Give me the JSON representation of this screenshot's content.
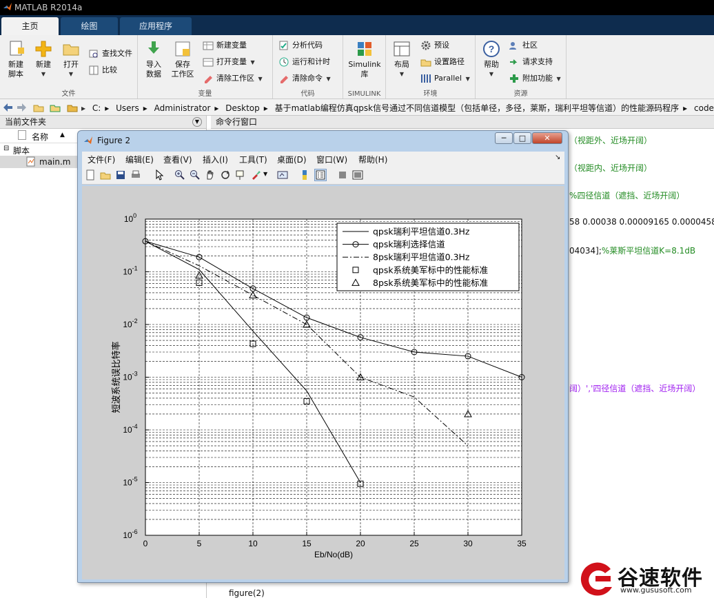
{
  "window": {
    "title": "MATLAB R2014a"
  },
  "tabs": [
    {
      "label": "主页",
      "active": true
    },
    {
      "label": "绘图",
      "active": false
    },
    {
      "label": "应用程序",
      "active": false
    }
  ],
  "ribbon": {
    "groups": {
      "file": "文件",
      "variable": "变量",
      "code": "代码",
      "simulink": "SIMULINK",
      "env": "环境",
      "resources": "资源"
    },
    "new_script": "新建\n脚本",
    "new": "新建",
    "open": "打开",
    "find_files": "查找文件",
    "compare": "比较",
    "import": "导入\n数据",
    "save_ws": "保存\n工作区",
    "new_var": "新建变量",
    "open_var": "打开变量",
    "clear_ws": "清除工作区",
    "analyze": "分析代码",
    "run_time": "运行和计时",
    "clear_cmd": "清除命令",
    "simulink": "Simulink\n库",
    "layout": "布局",
    "prefs": "预设",
    "set_path": "设置路径",
    "parallel": "Parallel",
    "help": "帮助",
    "community": "社区",
    "support": "请求支持",
    "addons": "附加功能"
  },
  "address": {
    "segments": [
      "C:",
      "Users",
      "Administrator",
      "Desktop",
      "基于matlab编程仿真qpsk信号通过不同信道模型（包括单径，多径，莱斯，瑞利平坦等信道）的性能源码程序",
      "code"
    ]
  },
  "current_folder": {
    "title": "当前文件夹",
    "col_name": "名称",
    "sort": "▲",
    "group": "脚本",
    "file": "main.m"
  },
  "command_window": {
    "title": "命令行窗口",
    "lines": [
      {
        "text": "（视距外、近场开阔）",
        "color": "green",
        "y": 203
      },
      {
        "text": "（视距内、近场开阔）",
        "color": "green",
        "y": 243
      },
      {
        "text": "%四径信道（遮挡、近场开阔）",
        "color": "green",
        "y": 283
      },
      {
        "text": "58 0.00038 0.00009165 0.0000458",
        "color": "black",
        "y": 323
      },
      {
        "text": "04034];%莱斯平坦信道K=8.1dB",
        "color": "mixed",
        "y": 363
      },
      {
        "text": "阔）','四径信道（遮挡、近场开阔）",
        "color": "purple",
        "y": 563
      },
      {
        "text": "figure(2)",
        "color": "black",
        "y": 862
      }
    ]
  },
  "figure": {
    "title": "Figure 2",
    "menu": [
      "文件(F)",
      "编辑(E)",
      "查看(V)",
      "插入(I)",
      "工具(T)",
      "桌面(D)",
      "窗口(W)",
      "帮助(H)"
    ]
  },
  "chart_data": {
    "type": "line",
    "xlabel": "Eb/No(dB)",
    "ylabel": "短波系统误比特率",
    "x_ticks": [
      0,
      5,
      10,
      15,
      20,
      25,
      30,
      35
    ],
    "y_scale": "log",
    "y_ticks": [
      "10^0",
      "10^-1",
      "10^-2",
      "10^-3",
      "10^-4",
      "10^-5",
      "10^-6"
    ],
    "xlim": [
      0,
      35
    ],
    "ylim": [
      1e-06,
      1
    ],
    "grid": true,
    "legend_position": "top-right",
    "series": [
      {
        "name": "qpsk瑞利平坦信道0.3Hz",
        "style": "solid",
        "marker": "none",
        "x": [
          0,
          5,
          10,
          15,
          20
        ],
        "y": [
          0.38,
          0.11,
          0.0075,
          0.00055,
          1e-05
        ]
      },
      {
        "name": "qpsk瑞利选择信道",
        "style": "solid",
        "marker": "circle",
        "x": [
          0,
          5,
          10,
          15,
          20,
          25,
          30,
          35
        ],
        "y": [
          0.38,
          0.19,
          0.048,
          0.0135,
          0.0057,
          0.003,
          0.0025,
          0.001
        ]
      },
      {
        "name": "8psk瑞利平坦信道0.3Hz",
        "style": "dashdot",
        "marker": "none",
        "x": [
          0,
          5,
          10,
          15,
          20,
          25,
          30
        ],
        "y": [
          0.38,
          0.13,
          0.036,
          0.01,
          0.001,
          0.00042,
          5e-05
        ]
      },
      {
        "name": "qpsk系统美军标中的性能标准",
        "style": "none",
        "marker": "square",
        "x": [
          5,
          10,
          15,
          20
        ],
        "y": [
          0.062,
          0.0043,
          0.00035,
          9.5e-06
        ]
      },
      {
        "name": "8psk系统美军标中的性能标准",
        "style": "none",
        "marker": "triangle",
        "x": [
          5,
          10,
          15,
          20,
          30
        ],
        "y": [
          0.085,
          0.036,
          0.01,
          0.001,
          0.0002
        ]
      }
    ]
  },
  "watermark": {
    "name": "谷速软件",
    "url": "www.gususoft.com"
  }
}
